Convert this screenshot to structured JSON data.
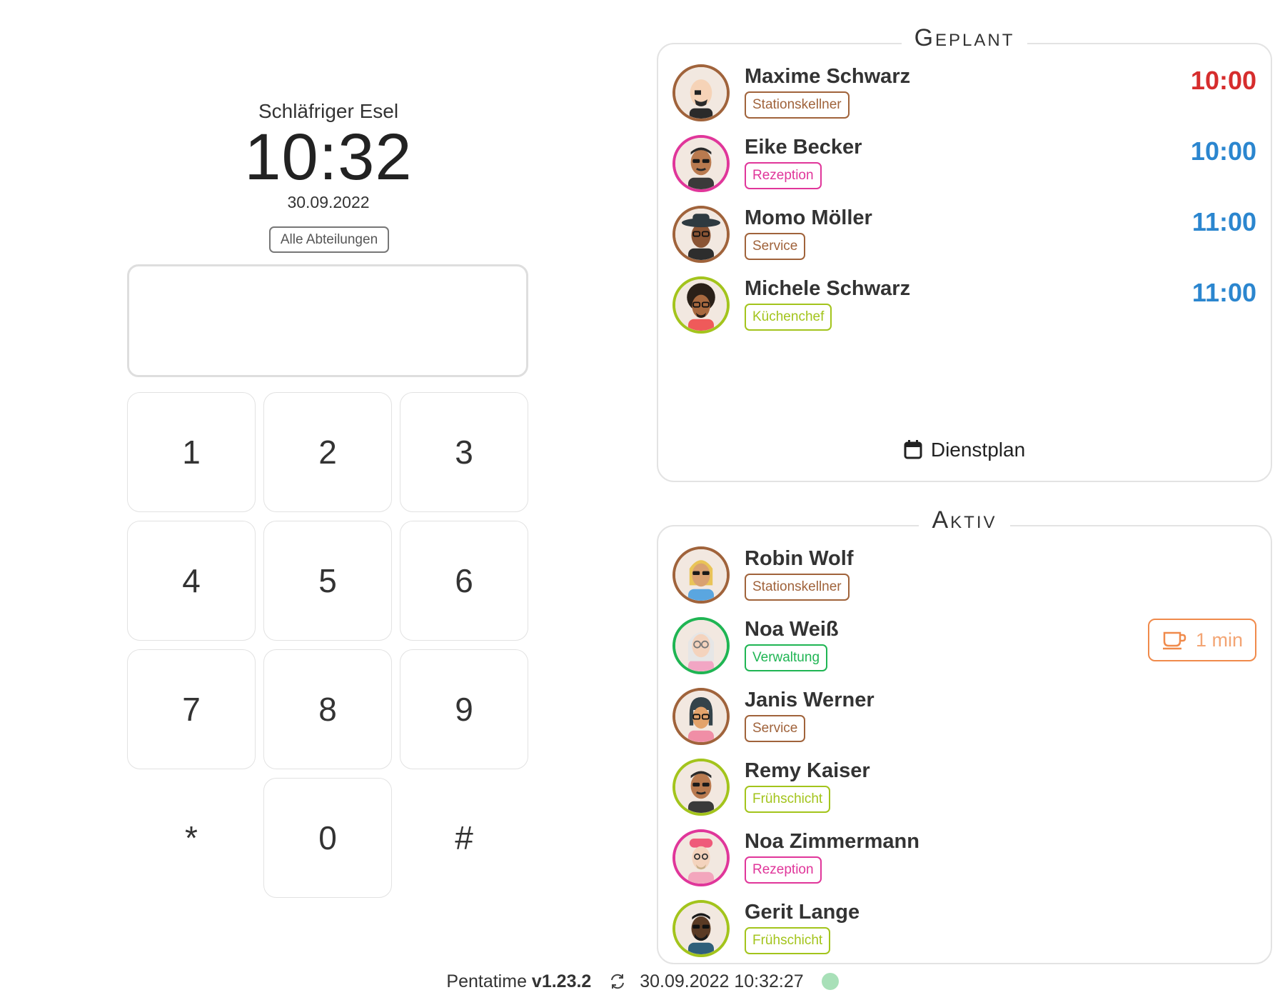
{
  "location": "Schläfriger Esel",
  "clock": "10:32",
  "date": "30.09.2022",
  "department_filter": "Alle Abteilungen",
  "keypad": [
    "1",
    "2",
    "3",
    "4",
    "5",
    "6",
    "7",
    "8",
    "9",
    "*",
    "0",
    "#"
  ],
  "geplant": {
    "title": "Geplant",
    "employees": [
      {
        "name": "Maxime Schwarz",
        "role": "Stationskellner",
        "role_color": "#a0633b",
        "time": "10:00",
        "time_color": "#d62d2d",
        "ring": "#a0633b"
      },
      {
        "name": "Eike Becker",
        "role": "Rezeption",
        "role_color": "#e0369a",
        "time": "10:00",
        "time_color": "#2b86cf",
        "ring": "#e0369a"
      },
      {
        "name": "Momo Möller",
        "role": "Service",
        "role_color": "#a0633b",
        "time": "11:00",
        "time_color": "#2b86cf",
        "ring": "#a0633b"
      },
      {
        "name": "Michele Schwarz",
        "role": "Küchenchef",
        "role_color": "#a3c41c",
        "time": "11:00",
        "time_color": "#2b86cf",
        "ring": "#a3c41c"
      }
    ],
    "dienstplan_label": "Dienstplan",
    "calendar_icon": "calendar-icon"
  },
  "aktiv": {
    "title": "Aktiv",
    "employees": [
      {
        "name": "Robin Wolf",
        "role": "Stationskellner",
        "role_color": "#a0633b",
        "ring": "#a0633b"
      },
      {
        "name": "Noa Weiß",
        "role": "Verwaltung",
        "role_color": "#1fb553",
        "ring": "#1fb553"
      },
      {
        "name": "Janis Werner",
        "role": "Service",
        "role_color": "#a0633b",
        "ring": "#a0633b"
      },
      {
        "name": "Remy Kaiser",
        "role": "Frühschicht",
        "role_color": "#a3c41c",
        "ring": "#a3c41c"
      },
      {
        "name": "Noa Zimmermann",
        "role": "Rezeption",
        "role_color": "#e0369a",
        "ring": "#e0369a"
      },
      {
        "name": "Gerit Lange",
        "role": "Frühschicht",
        "role_color": "#a3c41c",
        "ring": "#a3c41c"
      }
    ],
    "break": {
      "label": "1 min",
      "icon": "coffee-cup-icon",
      "color": "#f08a4b"
    }
  },
  "footer": {
    "app_name": "Pentatime",
    "version": "v1.23.2",
    "sync_icon": "sync-icon",
    "timestamp": "30.09.2022 10:32:27",
    "status_color": "#a8e0b8"
  }
}
